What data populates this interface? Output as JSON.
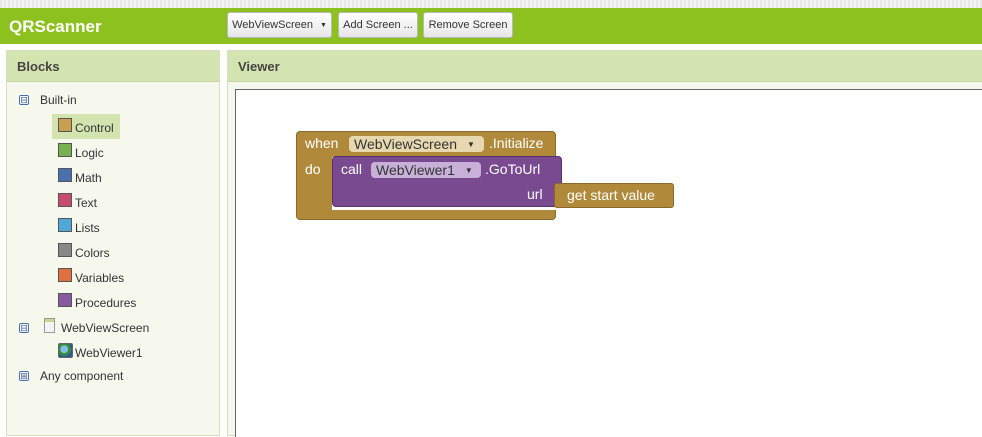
{
  "app": {
    "title": "QRScanner"
  },
  "toolbar": {
    "screen_select": "WebViewScreen",
    "add_screen": "Add Screen ...",
    "remove_screen": "Remove Screen"
  },
  "blocks_panel": {
    "title": "Blocks",
    "builtin_label": "Built-in",
    "builtin_toggle": "⊟",
    "items": [
      {
        "label": "Control",
        "color": "#c8a050"
      },
      {
        "label": "Logic",
        "color": "#78b050"
      },
      {
        "label": "Math",
        "color": "#4a70b0"
      },
      {
        "label": "Text",
        "color": "#c84a70"
      },
      {
        "label": "Lists",
        "color": "#50a8d8"
      },
      {
        "label": "Colors",
        "color": "#888888"
      },
      {
        "label": "Variables",
        "color": "#e07040"
      },
      {
        "label": "Procedures",
        "color": "#8a5aa0"
      }
    ],
    "screen_label": "WebViewScreen",
    "screen_toggle": "⊟",
    "component_label": "WebViewer1",
    "any_component_label": "Any component",
    "any_toggle": "⊞"
  },
  "viewer_panel": {
    "title": "Viewer"
  },
  "blocks": {
    "event_when": "when",
    "event_component": "WebViewScreen",
    "event_name": ".Initialize",
    "event_do": "do",
    "call_kw": "call",
    "call_component": "WebViewer1",
    "call_method": ".GoToUrl",
    "param_name": "url",
    "value_block": "get start value"
  }
}
